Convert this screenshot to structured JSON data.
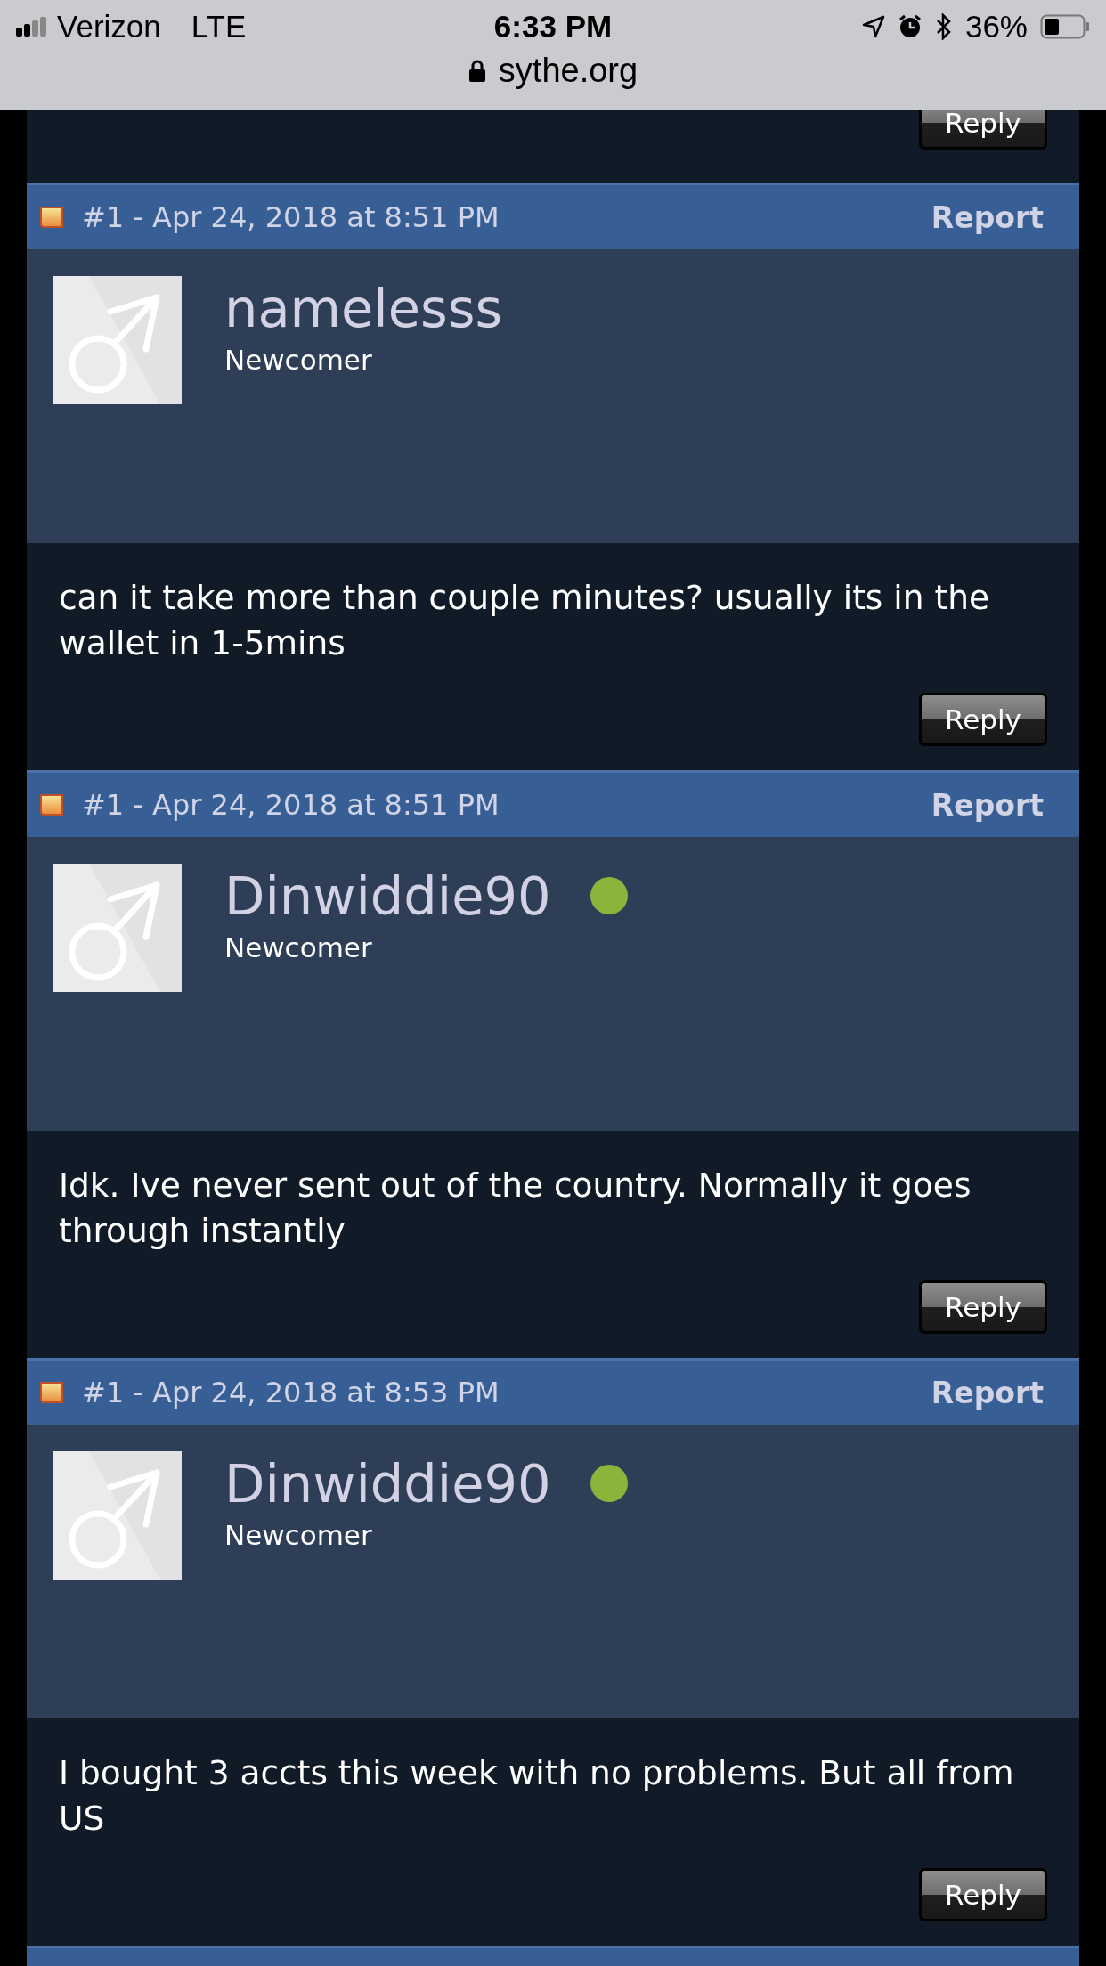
{
  "status_bar": {
    "carrier": "Verizon",
    "network": "LTE",
    "time": "6:33 PM",
    "battery": "36%"
  },
  "address_bar": {
    "url": "sythe.org"
  },
  "top_reply": "Reply",
  "posts": [
    {
      "meta": "#1 - Apr 24, 2018 at 8:51 PM",
      "report": "Report",
      "username": "namelesss",
      "online": false,
      "rank": "Newcomer",
      "message": "can it take more than couple minutes? usually its in the wallet in 1-5mins",
      "reply": "Reply"
    },
    {
      "meta": "#1 - Apr 24, 2018 at 8:51 PM",
      "report": "Report",
      "username": "Dinwiddie90",
      "online": true,
      "rank": "Newcomer",
      "message": "Idk. Ive never sent out of the country. Normally it goes through instantly",
      "reply": "Reply"
    },
    {
      "meta": "#1 - Apr 24, 2018 at 8:53 PM",
      "report": "Report",
      "username": "Dinwiddie90",
      "online": true,
      "rank": "Newcomer",
      "message": "I bought 3 accts this week with no problems. But all from US",
      "reply": "Reply"
    }
  ]
}
